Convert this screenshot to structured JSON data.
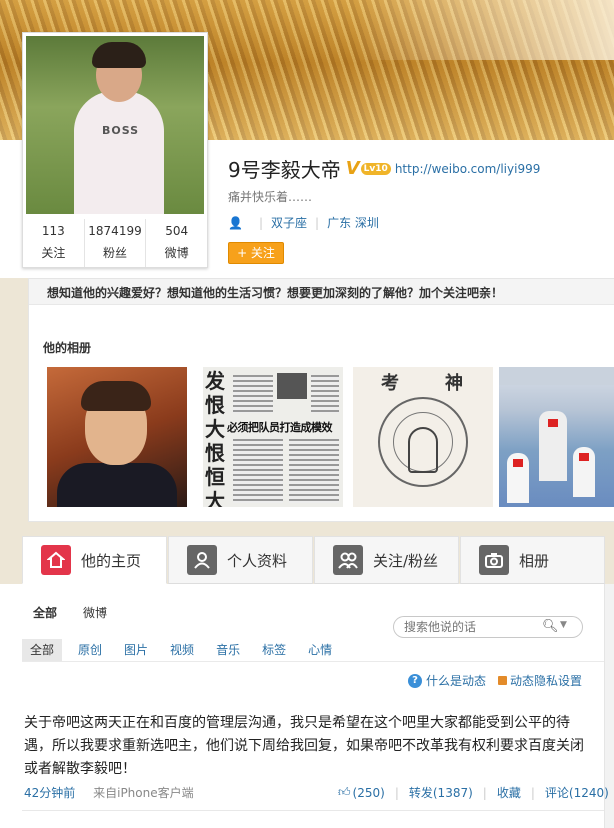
{
  "profile": {
    "name": "9号李毅大帝",
    "verified_mark": "V",
    "level_badge": "Lv10",
    "homepage": "http://weibo.com/liyi999",
    "bio": "痛并快乐着……",
    "zodiac": "双子座",
    "location": "广东 深圳",
    "follow_button": "+ 关注",
    "avatar_logo": "BOSS",
    "stats": [
      {
        "num": "113",
        "label": "关注"
      },
      {
        "num": "1874199",
        "label": "粉丝"
      },
      {
        "num": "504",
        "label": "微博"
      }
    ]
  },
  "promo": {
    "text": "想知道他的兴趣爱好？想知道他的生活习惯？想要更加深刻的了解他？加个关注吧亲！",
    "album_title": "他的相册",
    "album2_headline": "必须把队员打造成模效",
    "album2_big": "发恨大恨恒大",
    "album3_chars": [
      "考",
      "神"
    ]
  },
  "nav": {
    "tabs": [
      {
        "label": "他的主页",
        "icon": "home-icon"
      },
      {
        "label": "个人资料",
        "icon": "person-icon"
      },
      {
        "label": "关注/粉丝",
        "icon": "people-icon"
      },
      {
        "label": "相册",
        "icon": "camera-icon"
      }
    ]
  },
  "feed": {
    "subtabs": [
      "全部",
      "微博"
    ],
    "search_placeholder": "搜索他说的话",
    "filters": [
      "全部",
      "原创",
      "图片",
      "视频",
      "音乐",
      "标签",
      "心情"
    ],
    "what_is_feed": "什么是动态",
    "privacy": "动态隐私设置",
    "post": {
      "text": "关于帝吧这两天正在和百度的管理层沟通，我只是希望在这个吧里大家都能受到公平的待遇，所以我要求重新选吧主，他们说下周给我回复，如果帝吧不改革我有权利要求百度关闭或者解散李毅吧！",
      "time": "42分钟前",
      "source": "来自iPhone客户端",
      "likes": "(250)",
      "repost": "转发(1387)",
      "favorite": "收藏",
      "comment": "评论(1240)"
    }
  },
  "colors": {
    "accent_orange": "#f7a11b",
    "link_blue": "#2a6fa5",
    "active_tab_red": "#e3354a"
  }
}
